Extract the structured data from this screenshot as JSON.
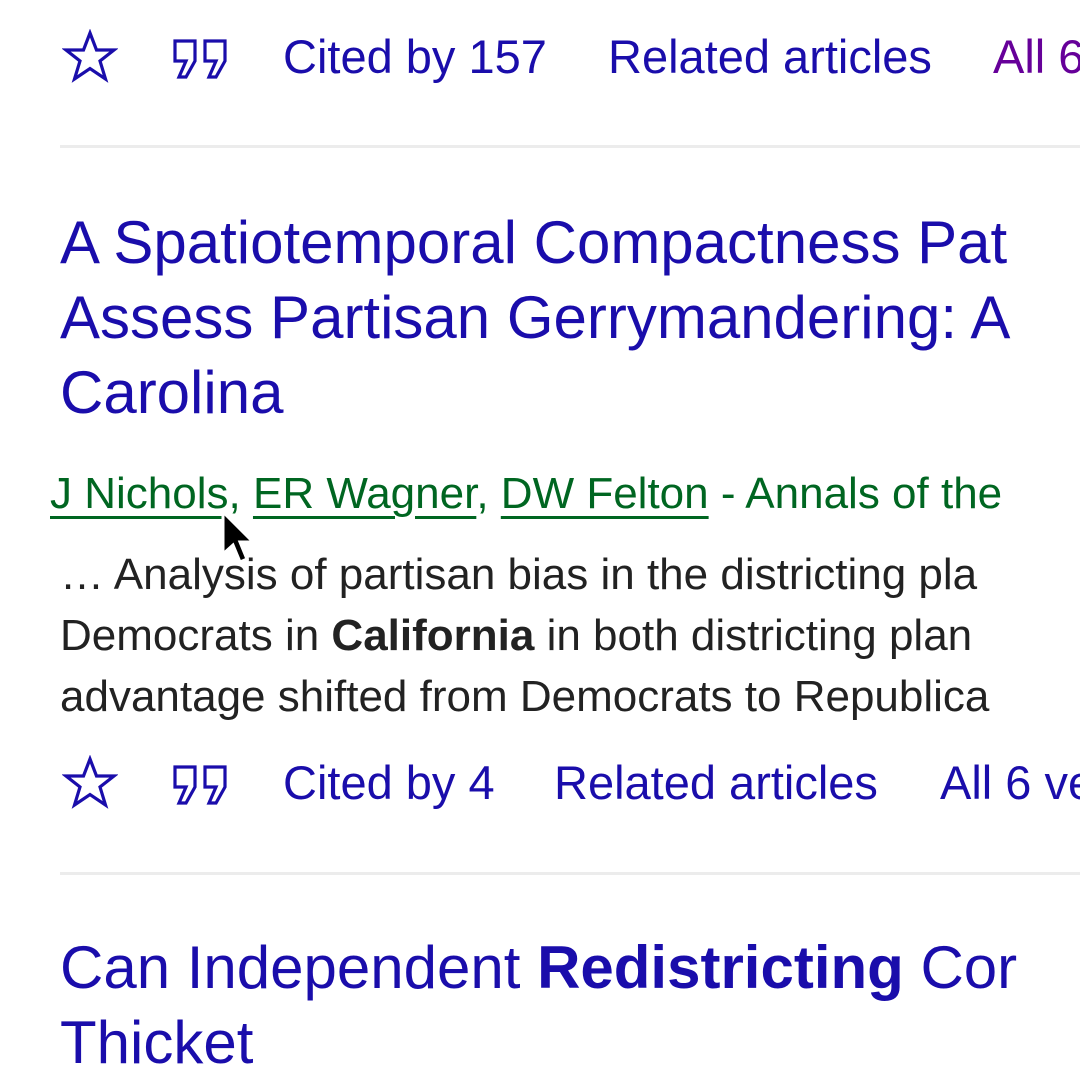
{
  "result1": {
    "actions": {
      "save_icon": "star-icon",
      "cite_icon": "quote-icon",
      "cited_by": "Cited by 157",
      "related": "Related articles",
      "versions": "All 6"
    }
  },
  "result2": {
    "title_line1": "A Spatiotemporal Compactness Pat",
    "title_line2": "Assess Partisan Gerrymandering: A",
    "title_line3": "Carolina",
    "authors": [
      "J Nichols",
      "ER Wagner",
      "DW Felton"
    ],
    "separator": ",",
    "venue": " - Annals of the",
    "snippet": {
      "line1": "… Analysis of partisan bias in the districting pla",
      "line2_pre": "Democrats in ",
      "line2_bold": "California",
      "line2_post": " in both districting plan",
      "line3": "advantage shifted from Democrats to Republica"
    },
    "actions": {
      "save_icon": "star-icon",
      "cite_icon": "quote-icon",
      "cited_by": "Cited by 4",
      "related": "Related articles",
      "versions": "All 6 ve"
    }
  },
  "result3": {
    "title_pre": "Can Independent ",
    "title_bold": "Redistricting",
    "title_post": " Cor",
    "title_line2": "Thicket"
  },
  "colors": {
    "link": "#1a0dab",
    "visited": "#660099",
    "author_green": "#006621",
    "snippet_text": "#222222",
    "divider": "#ececec"
  }
}
